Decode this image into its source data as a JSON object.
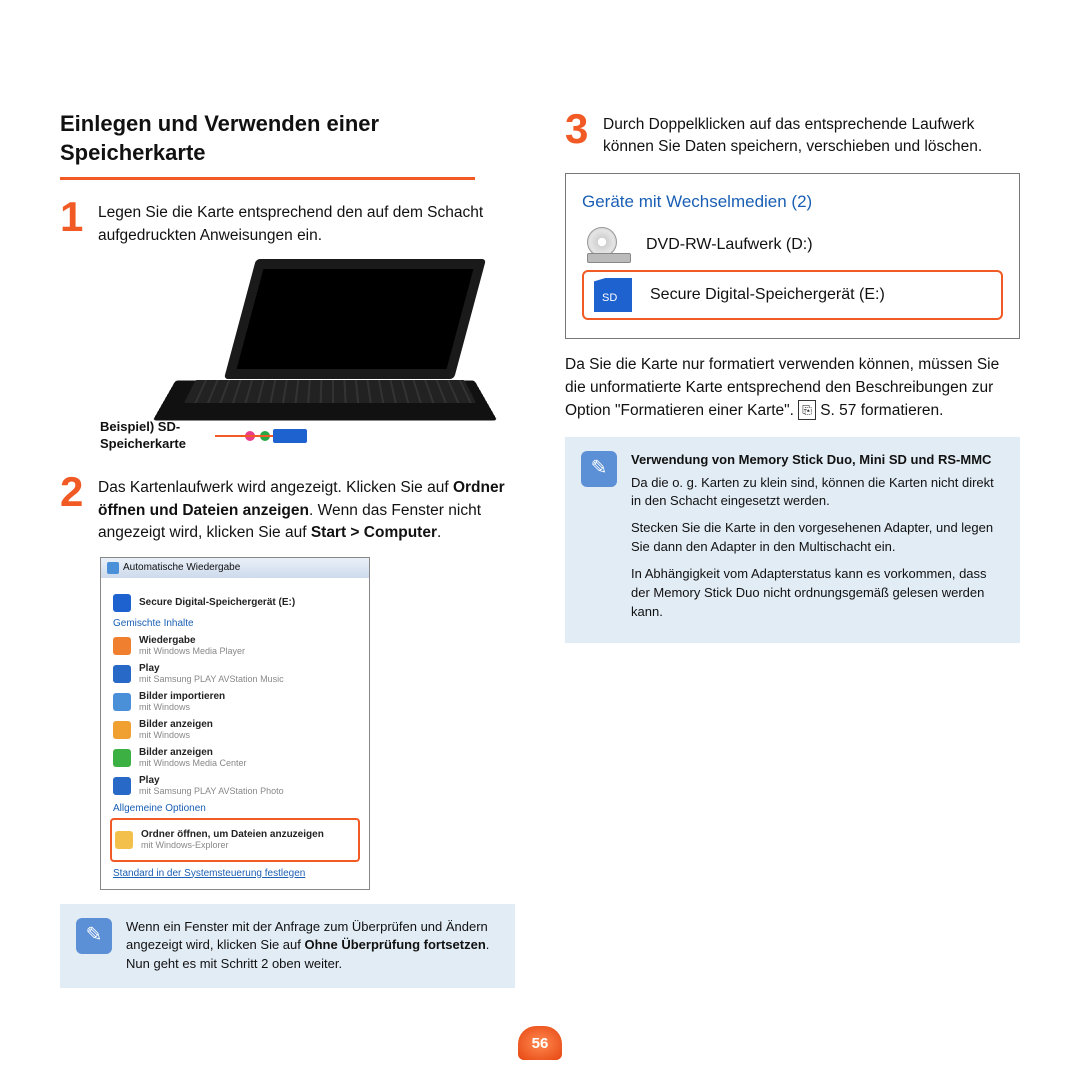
{
  "title": "Einlegen und Verwenden einer Speicherkarte",
  "steps": {
    "s1": {
      "num": "1",
      "text": "Legen Sie die Karte entsprechend den auf dem Schacht aufgedruckten Anweisungen ein."
    },
    "s2": {
      "num": "2",
      "pre": "Das Kartenlaufwerk wird angezeigt. Klicken Sie auf ",
      "bold1": "Ordner öffnen und Dateien anzeigen",
      "mid": ". Wenn das Fenster nicht angezeigt wird, klicken Sie auf ",
      "bold2": "Start > Computer",
      "end": "."
    },
    "s3": {
      "num": "3",
      "text": "Durch Doppelklicken auf das entsprechende Laufwerk können Sie Daten speichern, verschieben und löschen."
    }
  },
  "callout": "Beispiel) SD-\nSpeicherkarte",
  "autoplay": {
    "title": "Automatische Wiedergabe",
    "device": "Secure Digital-Speichergerät (E:)",
    "section_mixed": "Gemischte Inhalte",
    "items": [
      {
        "label": "Wiedergabe",
        "sub": "mit Windows Media Player",
        "color": "#f08030"
      },
      {
        "label": "Play",
        "sub": "mit Samsung PLAY AVStation Music",
        "color": "#2868c7"
      },
      {
        "label": "Bilder importieren",
        "sub": "mit Windows",
        "color": "#4a90d9"
      },
      {
        "label": "Bilder anzeigen",
        "sub": "mit Windows",
        "color": "#f0a030"
      },
      {
        "label": "Bilder anzeigen",
        "sub": "mit Windows Media Center",
        "color": "#3cb043"
      },
      {
        "label": "Play",
        "sub": "mit Samsung PLAY AVStation Photo",
        "color": "#2868c7"
      }
    ],
    "section_general": "Allgemeine Optionen",
    "highlighted": {
      "label": "Ordner öffnen, um Dateien anzuzeigen",
      "sub": "mit Windows-Explorer"
    },
    "footer_link": "Standard in der Systemsteuerung festlegen"
  },
  "note_left": {
    "pre": "Wenn ein Fenster mit der Anfrage zum Überprüfen und Ändern angezeigt wird, klicken Sie auf ",
    "bold": "Ohne Überprüfung fortsetzen",
    "end": ". Nun geht es mit Schritt 2 oben weiter."
  },
  "drive_panel": {
    "heading": "Geräte mit Wechselmedien (2)",
    "dvd": "DVD-RW-Laufwerk (D:)",
    "sd": "Secure Digital-Speichergerät (E:)"
  },
  "format_para": {
    "pre": "Da Sie die Karte nur formatiert verwenden können, müssen Sie die unformatierte Karte entsprechend den Beschreibungen zur Option \"Formatieren einer Karte\". ",
    "ref_icon": "⎘",
    "ref": "S. 57",
    "end": " formatieren."
  },
  "note_right": {
    "title": "Verwendung von Memory Stick Duo, Mini SD und RS-MMC",
    "p1": "Da die o. g. Karten zu klein sind, können die Karten nicht direkt in den Schacht eingesetzt werden.",
    "p2": "Stecken Sie die Karte in den vorgesehenen Adapter, und legen Sie dann den Adapter in den Multischacht ein.",
    "p3": "In Abhängigkeit vom Adapterstatus kann es vorkommen, dass der Memory Stick Duo nicht ordnungsgemäß gelesen werden kann."
  },
  "page_number": "56"
}
